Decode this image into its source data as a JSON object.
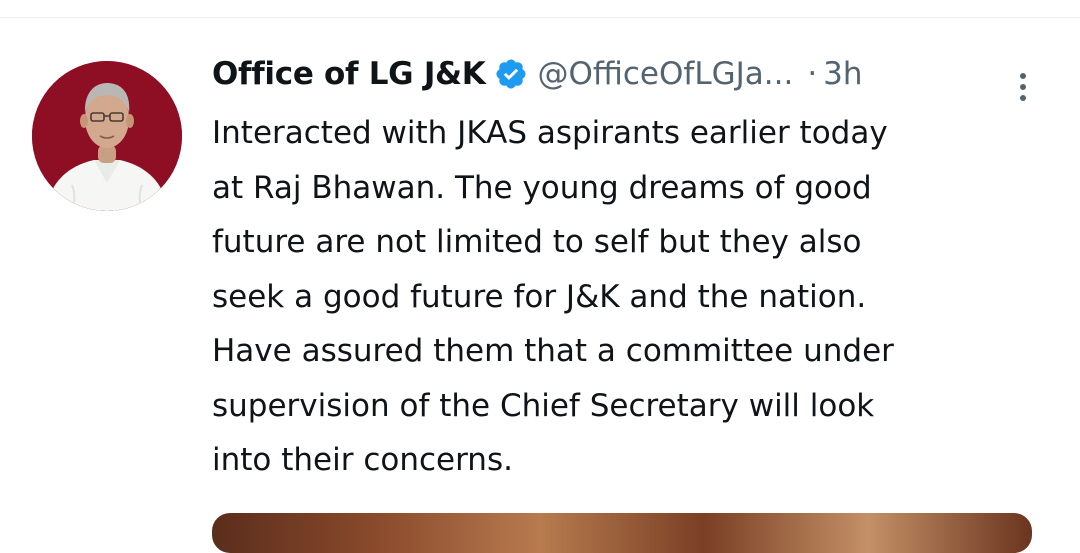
{
  "tweet": {
    "author": {
      "display_name": "Office of LG J&K",
      "verified": true,
      "handle": "@OfficeOfLGJa...",
      "avatar": "profile-photo"
    },
    "separator": "·",
    "timestamp": "3h",
    "more_icon": "more-vertical-icon",
    "text_lines": [
      "Interacted with JKAS aspirants earlier today",
      "at Raj Bhawan. The young dreams of good",
      "future are not limited to self but they also",
      "seek a good future for J&K and the nation.",
      "Have assured them that a committee under",
      "supervision of the Chief Secretary will look",
      "into their concerns."
    ],
    "colors": {
      "text": "#0f1419",
      "secondary": "#536471",
      "verified_badge": "#1d9bf0",
      "avatar_background": "#8e0f24"
    }
  }
}
